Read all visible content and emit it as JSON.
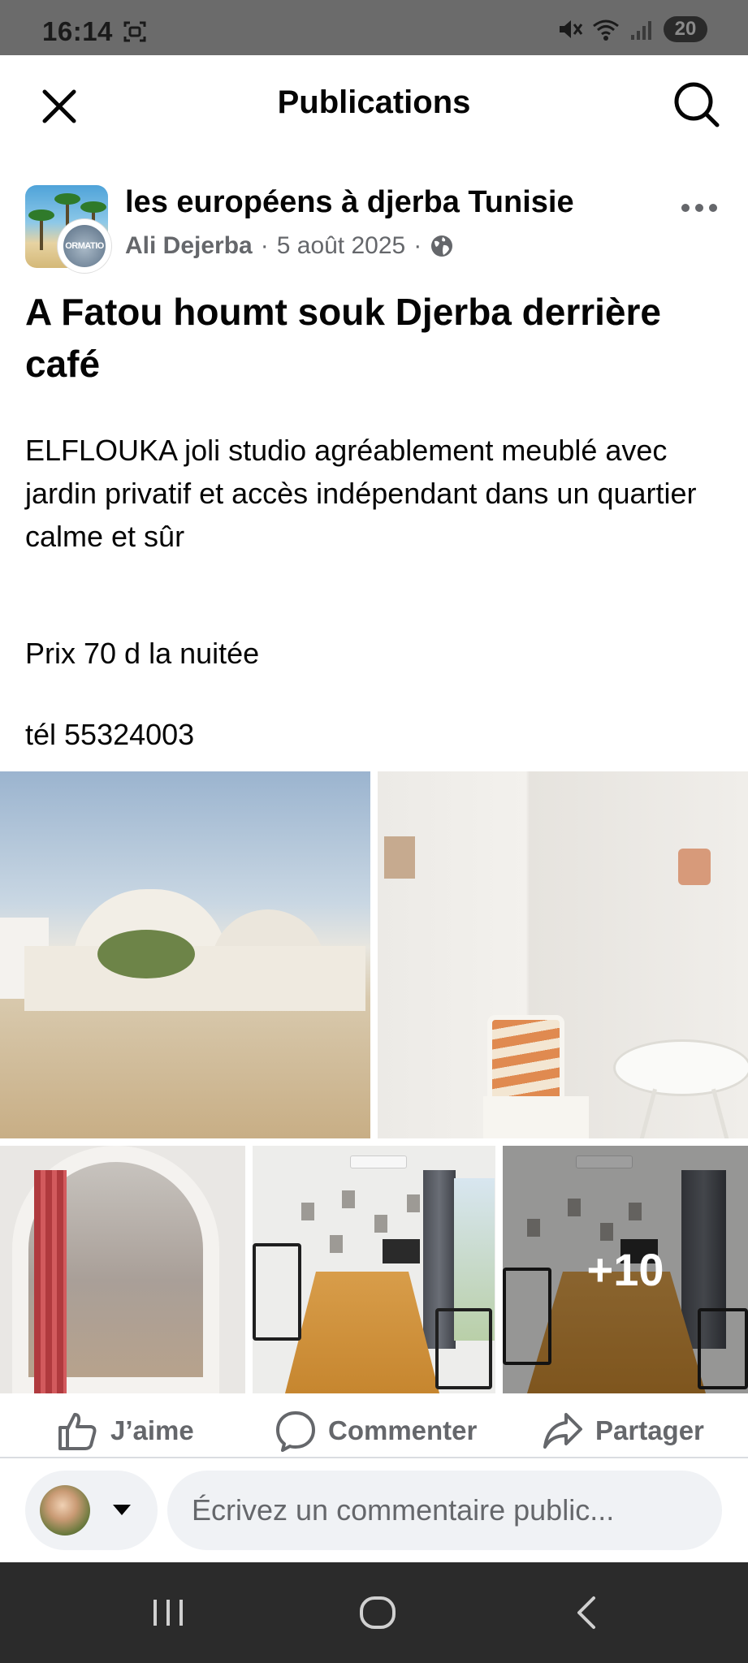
{
  "status_bar": {
    "time": "16:14",
    "battery": "20",
    "icons": [
      "screenshot-icon",
      "mute-icon",
      "wifi-icon",
      "signal-icon",
      "battery-icon"
    ]
  },
  "app_bar": {
    "title": "Publications",
    "close_icon": "close-icon",
    "search_icon": "search-icon"
  },
  "post": {
    "group_name": "les européens à djerba Tunisie",
    "author": "Ali Dejerba",
    "date": "5 août 2025",
    "separator": "·",
    "privacy_icon": "globe-icon",
    "avatar_badge_text": "ORMATIO",
    "title": "A Fatou houmt souk Djerba derrière café",
    "body_1": "ELFLOUKA joli studio agréablement meublé avec jardin privatif et accès indépendant dans un quartier calme et sûr",
    "body_2": "Prix 70 d la nuitée",
    "body_3": "tél 55324003",
    "photos": {
      "more_count": "+10"
    }
  },
  "actions": {
    "like": "J’aime",
    "comment": "Commenter",
    "share": "Partager"
  },
  "composer": {
    "placeholder": "Écrivez un commentaire public...",
    "value": ""
  },
  "nav_bar": {
    "icons": [
      "recent-apps-icon",
      "home-icon",
      "back-icon"
    ]
  },
  "colors": {
    "text_primary": "#050505",
    "text_secondary": "#65676b",
    "input_bg": "#f0f2f5",
    "status_bar_bg": "#6b6b6b",
    "nav_bar_bg": "#2b2b2b"
  }
}
